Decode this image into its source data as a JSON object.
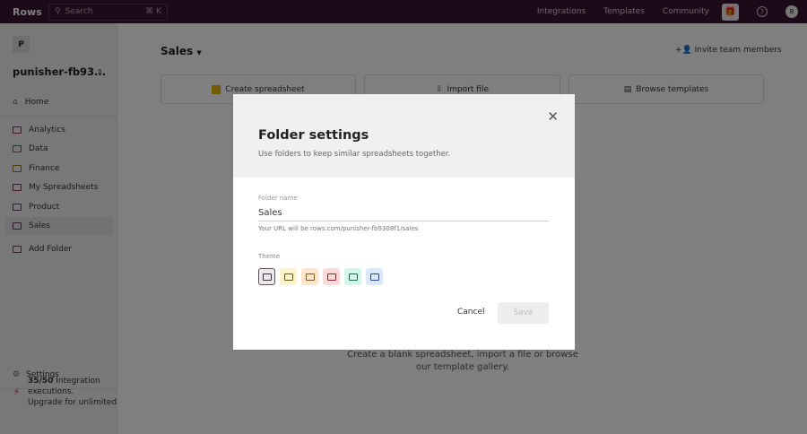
{
  "topbar": {
    "logo": "Rows",
    "search_placeholder": "Search",
    "search_shortcut": "⌘ K",
    "links": [
      "Integrations",
      "Templates",
      "Community"
    ],
    "help": "?",
    "avatar": "B"
  },
  "sidebar": {
    "workspace_badge": "P",
    "workspace_name": "punisher-fb93...",
    "items": [
      {
        "label": "Home",
        "icon": "home-icon",
        "color": "#555555"
      },
      {
        "label": "Analytics",
        "icon": "folder-icon",
        "color": "#7a2f6a"
      },
      {
        "label": "Data",
        "icon": "folder-icon",
        "color": "#2f7a5a"
      },
      {
        "label": "Finance",
        "icon": "folder-icon",
        "color": "#a06a20"
      },
      {
        "label": "My Spreadsheets",
        "icon": "folder-icon",
        "color": "#7a2f6a"
      },
      {
        "label": "Product",
        "icon": "folder-icon",
        "color": "#7a2f6a"
      },
      {
        "label": "Sales",
        "icon": "folder-icon",
        "color": "#7a2f6a"
      },
      {
        "label": "Add Folder",
        "icon": "add-folder-icon",
        "color": "#7a2f6a"
      }
    ],
    "settings": "Settings",
    "usage_count": "35/50",
    "usage_line1": " Integration",
    "usage_line2": "executions.",
    "usage_line3": "Upgrade for unlimited"
  },
  "main": {
    "title": "Sales",
    "invite": "Invite team members",
    "cards": [
      "Create spreadsheet",
      "Import file",
      "Browse templates"
    ],
    "empty_text": "Create a blank spreadsheet, import a file or browse our template gallery."
  },
  "modal": {
    "title": "Folder settings",
    "subtitle": "Use folders to keep similar spreadsheets together.",
    "folder_label": "Folder name",
    "folder_value": "Sales",
    "url_help": "Your URL will be rows.com/punisher-fb9308f1/sales",
    "theme_label": "Theme",
    "themes": [
      {
        "bg": "#efe6ee",
        "fg": "#333333",
        "selected": true
      },
      {
        "bg": "#fdf3cf",
        "fg": "#6b5a10"
      },
      {
        "bg": "#fde6cc",
        "fg": "#8a5a20"
      },
      {
        "bg": "#fbdada",
        "fg": "#8a2a30"
      },
      {
        "bg": "#d4f5ea",
        "fg": "#1f6a50"
      },
      {
        "bg": "#dbe8fb",
        "fg": "#2a4a8a"
      }
    ],
    "cancel": "Cancel",
    "save": "Save"
  }
}
